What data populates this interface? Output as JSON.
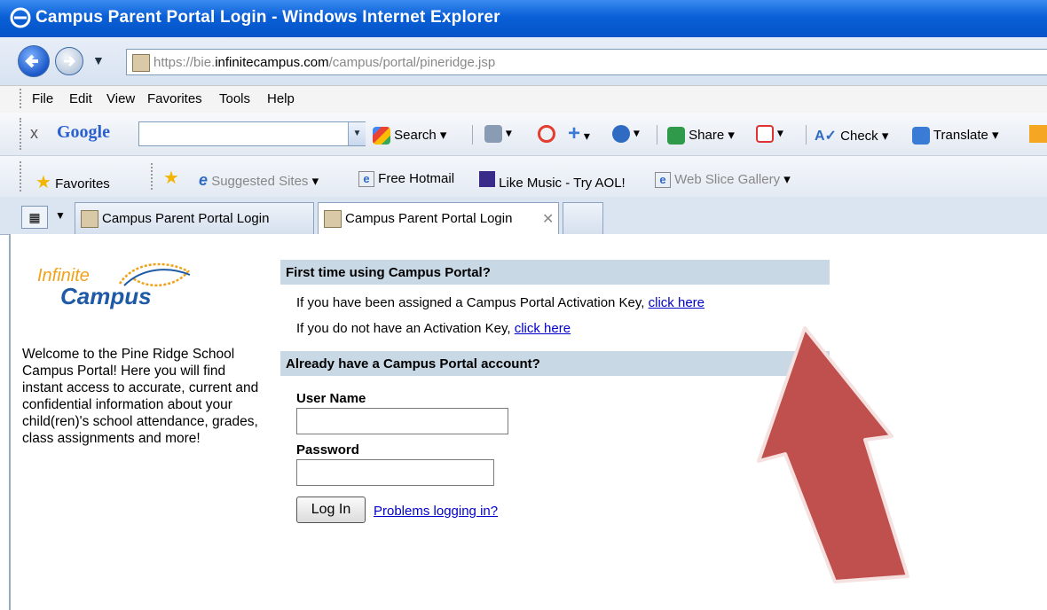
{
  "window": {
    "title": "Campus Parent Portal Login - Windows Internet Explorer"
  },
  "address": {
    "scheme": "https://",
    "host_prefix": "bie.",
    "host_main": "infinitecampus.com",
    "path": "/campus/portal/pineridge.jsp"
  },
  "menu": [
    "File",
    "Edit",
    "View",
    "Favorites",
    "Tools",
    "Help"
  ],
  "google_toolbar": {
    "close": "x",
    "brand": "Google",
    "search_label": "Search",
    "share_label": "Share",
    "check_label": "Check",
    "translate_label": "Translate"
  },
  "favorites_bar": {
    "favorites_label": "Favorites",
    "suggested_sites": "Suggested Sites",
    "free_hotmail": "Free Hotmail",
    "like_music": "Like Music - Try AOL!",
    "web_slice": "Web Slice Gallery"
  },
  "tabs": [
    {
      "label": "Campus Parent Portal Login",
      "active": false
    },
    {
      "label": "Campus Parent Portal Login",
      "active": true
    }
  ],
  "logo": {
    "line1": "Infinite",
    "line2": "Campus"
  },
  "welcome": "Welcome to the Pine Ridge School Campus Portal! Here you will find instant access to accurate, current and confidential information about your child(ren)'s school attendance, grades, class assignments and more!",
  "first_time": {
    "header": "First time using Campus Portal?",
    "line1": "If you have been assigned a Campus Portal Activation Key,",
    "line2": "If you do not have an Activation Key,",
    "link": "click here"
  },
  "account": {
    "header": "Already have a Campus Portal account?",
    "username_label": "User Name",
    "password_label": "Password",
    "login_button": "Log In",
    "problems_link": "Problems logging in?"
  },
  "colors": {
    "title_bar": "#0a5fd6",
    "section_header": "#c9d8e5",
    "arrow_fill": "#c0504d",
    "link": "#0000cc"
  }
}
